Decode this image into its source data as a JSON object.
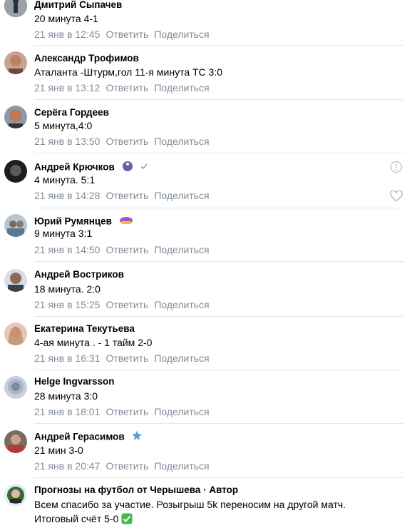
{
  "comments": [
    {
      "author": "Дмитрий Сыпачев",
      "text": "20 минута 4-1",
      "date": "21 янв в 12:45",
      "reply": "Ответить",
      "share": "Поделиться",
      "avatar_color": "#2b2f3a"
    },
    {
      "author": "Александр Трофимов",
      "text": "Аталанта -Штурм,гол 11-я минута ТС 3:0",
      "date": "21 янв в 13:12",
      "reply": "Ответить",
      "share": "Поделиться",
      "avatar_color": "#b9826a"
    },
    {
      "author": "Серёга Гордеев",
      "text": "5 минута,4:0",
      "date": "21 янв в 13:50",
      "reply": "Ответить",
      "share": "Поделиться",
      "avatar_color": "#c0785a"
    },
    {
      "author": "Андрей Крючков",
      "text": "4 минута. 5:1",
      "date": "21 янв в 14:28",
      "reply": "Ответить",
      "share": "Поделиться",
      "avatar_color": "#2e2e2e"
    },
    {
      "author": "Юрий Румянцев",
      "text": "9 минута 3:1",
      "date": "21 янв в 14:50",
      "reply": "Ответить",
      "share": "Поделиться",
      "avatar_color": "#7d8a99"
    },
    {
      "author": "Андрей Востриков",
      "text": "18 минута. 2:0",
      "date": "21 янв в 15:25",
      "reply": "Ответить",
      "share": "Поделиться",
      "avatar_color": "#3a4250"
    },
    {
      "author": "Екатерина Текутьева",
      "text": "4-ая минута . - 1 тайм 2-0",
      "date": "21 янв в 16:31",
      "reply": "Ответить",
      "share": "Поделиться",
      "avatar_color": "#d7a88f"
    },
    {
      "author": "Helge Ingvarsson",
      "text": "28 минута 3:0",
      "date": "21 янв в 18:01",
      "reply": "Ответить",
      "share": "Поделиться",
      "avatar_color": "#aab6c8"
    },
    {
      "author": "Андрей Герасимов",
      "text": "21 мин 3-0",
      "date": "21 янв в 20:47",
      "reply": "Ответить",
      "share": "Поделиться",
      "avatar_color": "#5a4a44"
    },
    {
      "author": "Прогнозы на футбол от Черышева · Автор",
      "text": "Всем спасибо за участие. Розыгрыш 5k переносим на другой матч.",
      "text2": "Итоговый счёт 5-0",
      "avatar_color": "#3a6b3a"
    }
  ],
  "icons": {
    "verified": "checkmark-icon",
    "report": "exclamation-circle-icon",
    "like": "heart-icon",
    "check_emoji": "check-emoji"
  },
  "colors": {
    "meta": "#818c99",
    "separator": "#e7e8ec",
    "check_green": "#3fb950"
  }
}
